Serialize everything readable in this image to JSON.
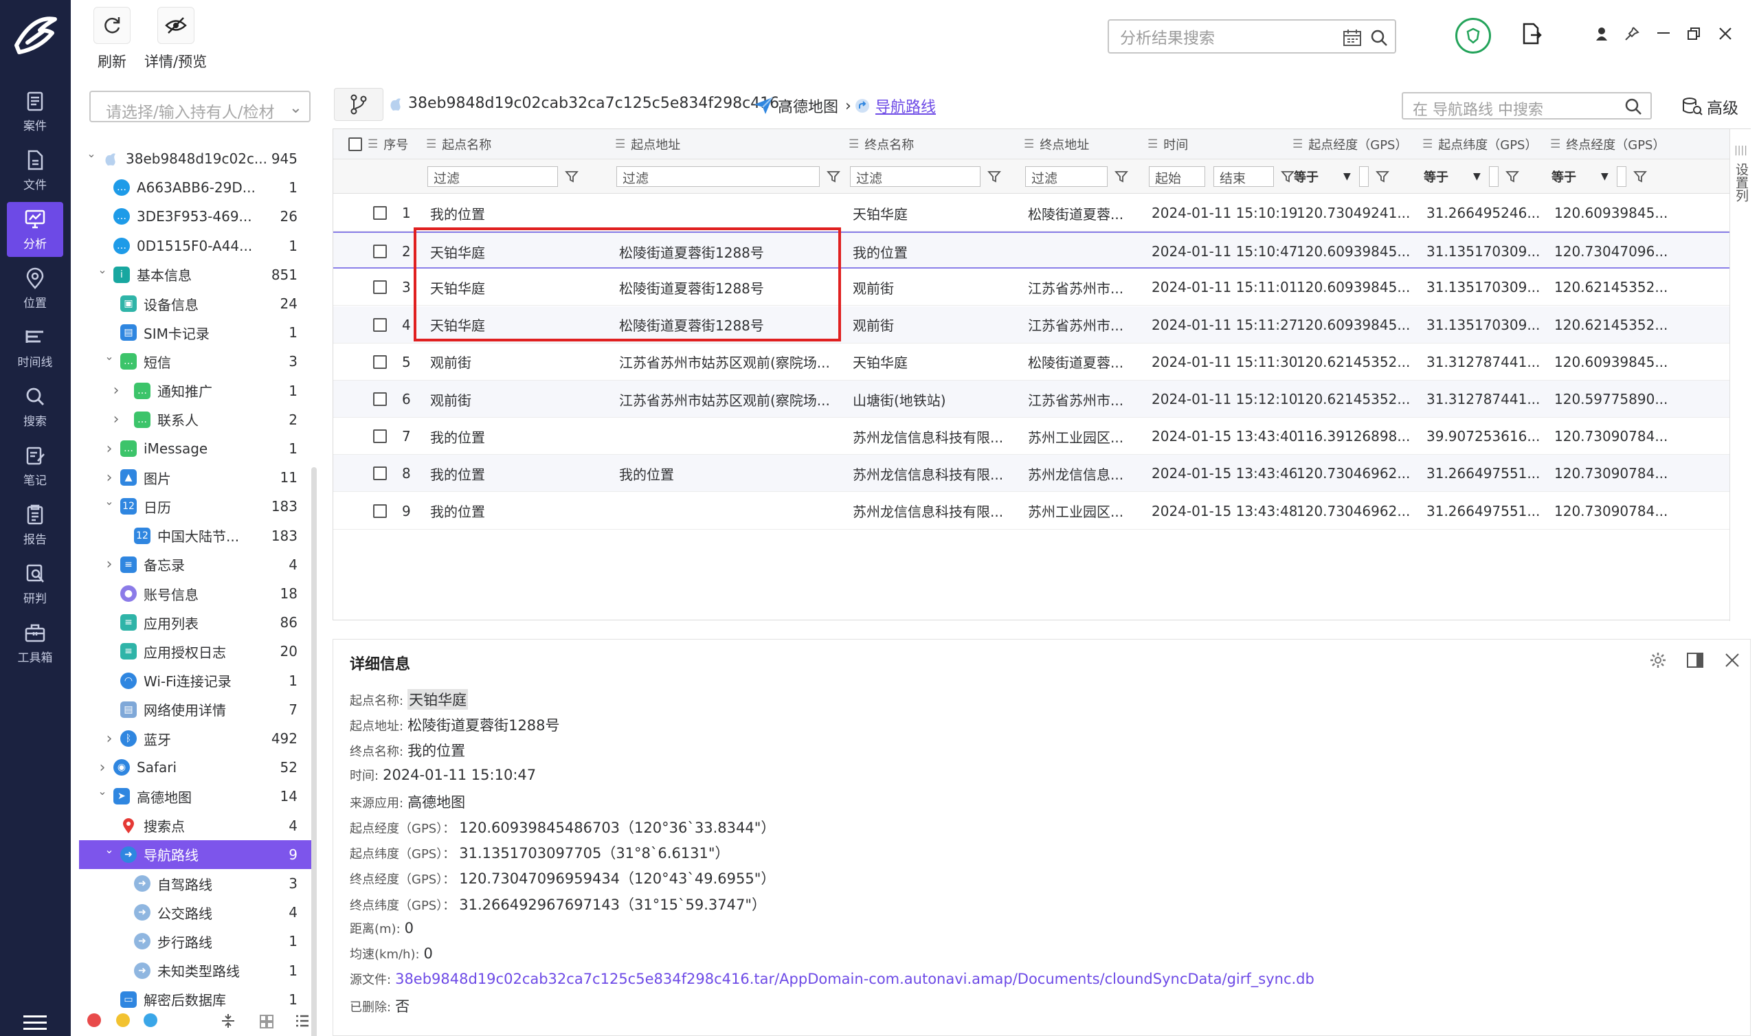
{
  "toolbar": {
    "refresh": "刷新",
    "detail_preview": "详情/预览"
  },
  "top_search": {
    "placeholder": "分析结果搜索"
  },
  "nav": [
    {
      "label": "案件",
      "icon": "case-icon"
    },
    {
      "label": "文件",
      "icon": "file-icon"
    },
    {
      "label": "分析",
      "icon": "analysis-icon",
      "active": true
    },
    {
      "label": "位置",
      "icon": "location-icon"
    },
    {
      "label": "时间线",
      "icon": "timeline-icon"
    },
    {
      "label": "搜索",
      "icon": "search-icon"
    },
    {
      "label": "笔记",
      "icon": "note-icon"
    },
    {
      "label": "报告",
      "icon": "report-icon"
    },
    {
      "label": "研判",
      "icon": "judge-icon"
    },
    {
      "label": "工具箱",
      "icon": "toolbox-icon"
    }
  ],
  "tree": {
    "search_placeholder": "请选择/输入持有人/检材",
    "items": [
      {
        "label": "38eb9848d19c02c...",
        "count": "945",
        "level": 0,
        "arrow": "v",
        "icon": "apple-icon",
        "color": "#9fc4ea"
      },
      {
        "label": "A663ABB6-29D...",
        "count": "1",
        "level": 1,
        "arrow": "",
        "icon": "chat-icon",
        "color": "#1e9be8"
      },
      {
        "label": "3DE3F953-469...",
        "count": "26",
        "level": 1,
        "arrow": "",
        "icon": "chat-icon",
        "color": "#1e9be8"
      },
      {
        "label": "0D1515F0-A44...",
        "count": "1",
        "level": 1,
        "arrow": "",
        "icon": "chat-icon",
        "color": "#1e9be8"
      },
      {
        "label": "基本信息",
        "count": "851",
        "level": 1,
        "arrow": "v",
        "icon": "info-icon",
        "color": "#18a7a0"
      },
      {
        "label": "设备信息",
        "count": "24",
        "level": 2,
        "arrow": "",
        "icon": "device-icon",
        "color": "#2fb4a8"
      },
      {
        "label": "SIM卡记录",
        "count": "1",
        "level": 2,
        "arrow": "",
        "icon": "sim-icon",
        "color": "#2f86e0"
      },
      {
        "label": "短信",
        "count": "3",
        "level": 2,
        "arrow": "v",
        "icon": "sms-icon",
        "color": "#3cc46a"
      },
      {
        "label": "通知推广",
        "count": "1",
        "level": 3,
        "arrow": ">",
        "icon": "sms-icon",
        "color": "#3cc46a"
      },
      {
        "label": "联系人",
        "count": "2",
        "level": 3,
        "arrow": ">",
        "icon": "sms-icon",
        "color": "#3cc46a"
      },
      {
        "label": "iMessage",
        "count": "1",
        "level": 2,
        "arrow": ">",
        "icon": "imessage-icon",
        "color": "#3cc46a"
      },
      {
        "label": "图片",
        "count": "11",
        "level": 2,
        "arrow": ">",
        "icon": "image-icon",
        "color": "#2f86e0"
      },
      {
        "label": "日历",
        "count": "183",
        "level": 2,
        "arrow": "v",
        "icon": "calendar-icon",
        "color": "#2f86e0"
      },
      {
        "label": "中国大陆节...",
        "count": "183",
        "level": 3,
        "arrow": "",
        "icon": "calendar-icon",
        "color": "#2f86e0"
      },
      {
        "label": "备忘录",
        "count": "4",
        "level": 2,
        "arrow": ">",
        "icon": "memo-icon",
        "color": "#2f86e0"
      },
      {
        "label": "账号信息",
        "count": "18",
        "level": 2,
        "arrow": "",
        "icon": "account-icon",
        "color": "#8b7be8"
      },
      {
        "label": "应用列表",
        "count": "86",
        "level": 2,
        "arrow": "",
        "icon": "applist-icon",
        "color": "#2fb4a8"
      },
      {
        "label": "应用授权日志",
        "count": "20",
        "level": 2,
        "arrow": "",
        "icon": "applog-icon",
        "color": "#2fb4a8"
      },
      {
        "label": "Wi-Fi连接记录",
        "count": "1",
        "level": 2,
        "arrow": "",
        "icon": "wifi-icon",
        "color": "#2f86e0"
      },
      {
        "label": "网络使用详情",
        "count": "7",
        "level": 2,
        "arrow": "",
        "icon": "network-icon",
        "color": "#7fa8d8"
      },
      {
        "label": "蓝牙",
        "count": "492",
        "level": 2,
        "arrow": ">",
        "icon": "bluetooth-icon",
        "color": "#2f86e0"
      },
      {
        "label": "Safari",
        "count": "52",
        "level": 1,
        "arrow": ">",
        "icon": "safari-icon",
        "color": "#2f86e0"
      },
      {
        "label": "高德地图",
        "count": "14",
        "level": 1,
        "arrow": "v",
        "icon": "amap-icon",
        "color": "#2f86e0"
      },
      {
        "label": "搜索点",
        "count": "4",
        "level": 2,
        "arrow": "",
        "icon": "pin-icon",
        "color": "#e33"
      },
      {
        "label": "导航路线",
        "count": "9",
        "level": 2,
        "arrow": "v",
        "icon": "route-icon",
        "color": "#2f86e0",
        "selected": true
      },
      {
        "label": "自驾路线",
        "count": "3",
        "level": 3,
        "arrow": "",
        "icon": "route-icon",
        "color": "#8fb6e0"
      },
      {
        "label": "公交路线",
        "count": "4",
        "level": 3,
        "arrow": "",
        "icon": "route-icon",
        "color": "#8fb6e0"
      },
      {
        "label": "步行路线",
        "count": "1",
        "level": 3,
        "arrow": "",
        "icon": "route-icon",
        "color": "#8fb6e0"
      },
      {
        "label": "未知类型路线",
        "count": "1",
        "level": 3,
        "arrow": "",
        "icon": "route-icon",
        "color": "#8fb6e0"
      },
      {
        "label": "解密后数据库",
        "count": "1",
        "level": 2,
        "arrow": "",
        "icon": "database-icon",
        "color": "#2f86e0"
      }
    ]
  },
  "breadcrumb": {
    "device": "38eb9848d19c02cab32ca7c125c5e834f298c416",
    "app": "高德地图",
    "current": "导航路线"
  },
  "grid_search": {
    "placeholder": "在 导航路线 中搜索"
  },
  "advanced_label": "高级",
  "column_settings": "设置列",
  "columns": [
    "序号",
    "起点名称",
    "起点地址",
    "终点名称",
    "终点地址",
    "时间",
    "起点经度（GPS）",
    "起点纬度（GPS）",
    "终点经度（GPS）"
  ],
  "filters": {
    "text": "过滤",
    "start": "起始",
    "end": "结束",
    "equals": "等于"
  },
  "rows": [
    {
      "no": "1",
      "start_name": "我的位置",
      "start_addr": "",
      "end_name": "天铂华庭",
      "end_addr": "松陵街道夏蓉...",
      "time": "2024-01-11 15:10:19",
      "slon": "120.73049241...",
      "slat": "31.266495246...",
      "elon": "120.60939845..."
    },
    {
      "no": "2",
      "start_name": "天铂华庭",
      "start_addr": "松陵街道夏蓉街1288号",
      "end_name": "我的位置",
      "end_addr": "",
      "time": "2024-01-11 15:10:47",
      "slon": "120.60939845...",
      "slat": "31.135170309...",
      "elon": "120.73047096..."
    },
    {
      "no": "3",
      "start_name": "天铂华庭",
      "start_addr": "松陵街道夏蓉街1288号",
      "end_name": "观前街",
      "end_addr": "江苏省苏州市...",
      "time": "2024-01-11 15:11:01",
      "slon": "120.60939845...",
      "slat": "31.135170309...",
      "elon": "120.62145352..."
    },
    {
      "no": "4",
      "start_name": "天铂华庭",
      "start_addr": "松陵街道夏蓉街1288号",
      "end_name": "观前街",
      "end_addr": "江苏省苏州市...",
      "time": "2024-01-11 15:11:27",
      "slon": "120.60939845...",
      "slat": "31.135170309...",
      "elon": "120.62145352..."
    },
    {
      "no": "5",
      "start_name": "观前街",
      "start_addr": "江苏省苏州市姑苏区观前(察院场...",
      "end_name": "天铂华庭",
      "end_addr": "松陵街道夏蓉...",
      "time": "2024-01-11 15:11:30",
      "slon": "120.62145352...",
      "slat": "31.312787441...",
      "elon": "120.60939845..."
    },
    {
      "no": "6",
      "start_name": "观前街",
      "start_addr": "江苏省苏州市姑苏区观前(察院场...",
      "end_name": "山塘街(地铁站)",
      "end_addr": "江苏省苏州市...",
      "time": "2024-01-11 15:12:10",
      "slon": "120.62145352...",
      "slat": "31.312787441...",
      "elon": "120.59775890..."
    },
    {
      "no": "7",
      "start_name": "我的位置",
      "start_addr": "",
      "end_name": "苏州龙信信息科技有限...",
      "end_addr": "苏州工业园区...",
      "time": "2024-01-15 13:43:40",
      "slon": "116.39126898...",
      "slat": "39.907253616...",
      "elon": "120.73090784..."
    },
    {
      "no": "8",
      "start_name": "我的位置",
      "start_addr": "我的位置",
      "end_name": "苏州龙信信息科技有限...",
      "end_addr": "苏州龙信信息...",
      "time": "2024-01-15 13:43:46",
      "slon": "120.73046962...",
      "slat": "31.266497551...",
      "elon": "120.73090784..."
    },
    {
      "no": "9",
      "start_name": "我的位置",
      "start_addr": "",
      "end_name": "苏州龙信信息科技有限...",
      "end_addr": "苏州工业园区...",
      "time": "2024-01-15 13:43:48",
      "slon": "120.73046962...",
      "slat": "31.266497551...",
      "elon": "120.73090784..."
    }
  ],
  "detail": {
    "title": "详细信息",
    "fields": [
      {
        "label": "起点名称:",
        "value": "天铂华庭",
        "style": "hl"
      },
      {
        "label": "起点地址:",
        "value": "松陵街道夏蓉街1288号",
        "style": ""
      },
      {
        "label": "终点名称:",
        "value": "我的位置",
        "style": ""
      },
      {
        "label": "时间:",
        "value": "2024-01-11 15:10:47",
        "style": ""
      },
      {
        "label": "来源应用:",
        "value": "高德地图",
        "style": ""
      },
      {
        "label": "起点经度（GPS）：",
        "value": "120.60939845486703（120°36`33.8344\"）",
        "style": ""
      },
      {
        "label": "起点纬度（GPS）：",
        "value": "31.1351703097705（31°8`6.6131\"）",
        "style": ""
      },
      {
        "label": "终点经度（GPS）：",
        "value": "120.73047096959434（120°43`49.6955\"）",
        "style": ""
      },
      {
        "label": "终点纬度（GPS）：",
        "value": "31.266492967697143（31°15`59.3747\"）",
        "style": ""
      },
      {
        "label": "距离(m):",
        "value": "0",
        "style": ""
      },
      {
        "label": "均速(km/h):",
        "value": "0",
        "style": ""
      },
      {
        "label": "源文件:",
        "value": "38eb9848d19c02cab32ca7c125c5e834f298c416.tar/AppDomain-com.autonavi.amap/Documents/cloundSyncData/girf_sync.db",
        "style": "link"
      },
      {
        "label": "已删除:",
        "value": "否",
        "style": ""
      }
    ]
  },
  "colors": {
    "nav_bg": "#1b2240",
    "accent": "#6d4ae6",
    "highlight_box": "#e02020"
  }
}
